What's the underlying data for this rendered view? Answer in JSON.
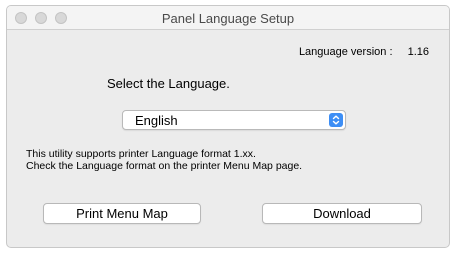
{
  "window": {
    "title": "Panel Language Setup"
  },
  "language_version": {
    "label": "Language version :",
    "value": "1.16"
  },
  "heading": "Select the Language.",
  "language_select": {
    "selected": "English",
    "icon": "updown-chevron-icon",
    "accent": "#3d8ef5"
  },
  "description": {
    "line1": "This utility supports printer Language format 1.xx.",
    "line2": "Check the Language format on the printer Menu Map page."
  },
  "buttons": {
    "print_menu_map": "Print Menu Map",
    "download": "Download"
  }
}
